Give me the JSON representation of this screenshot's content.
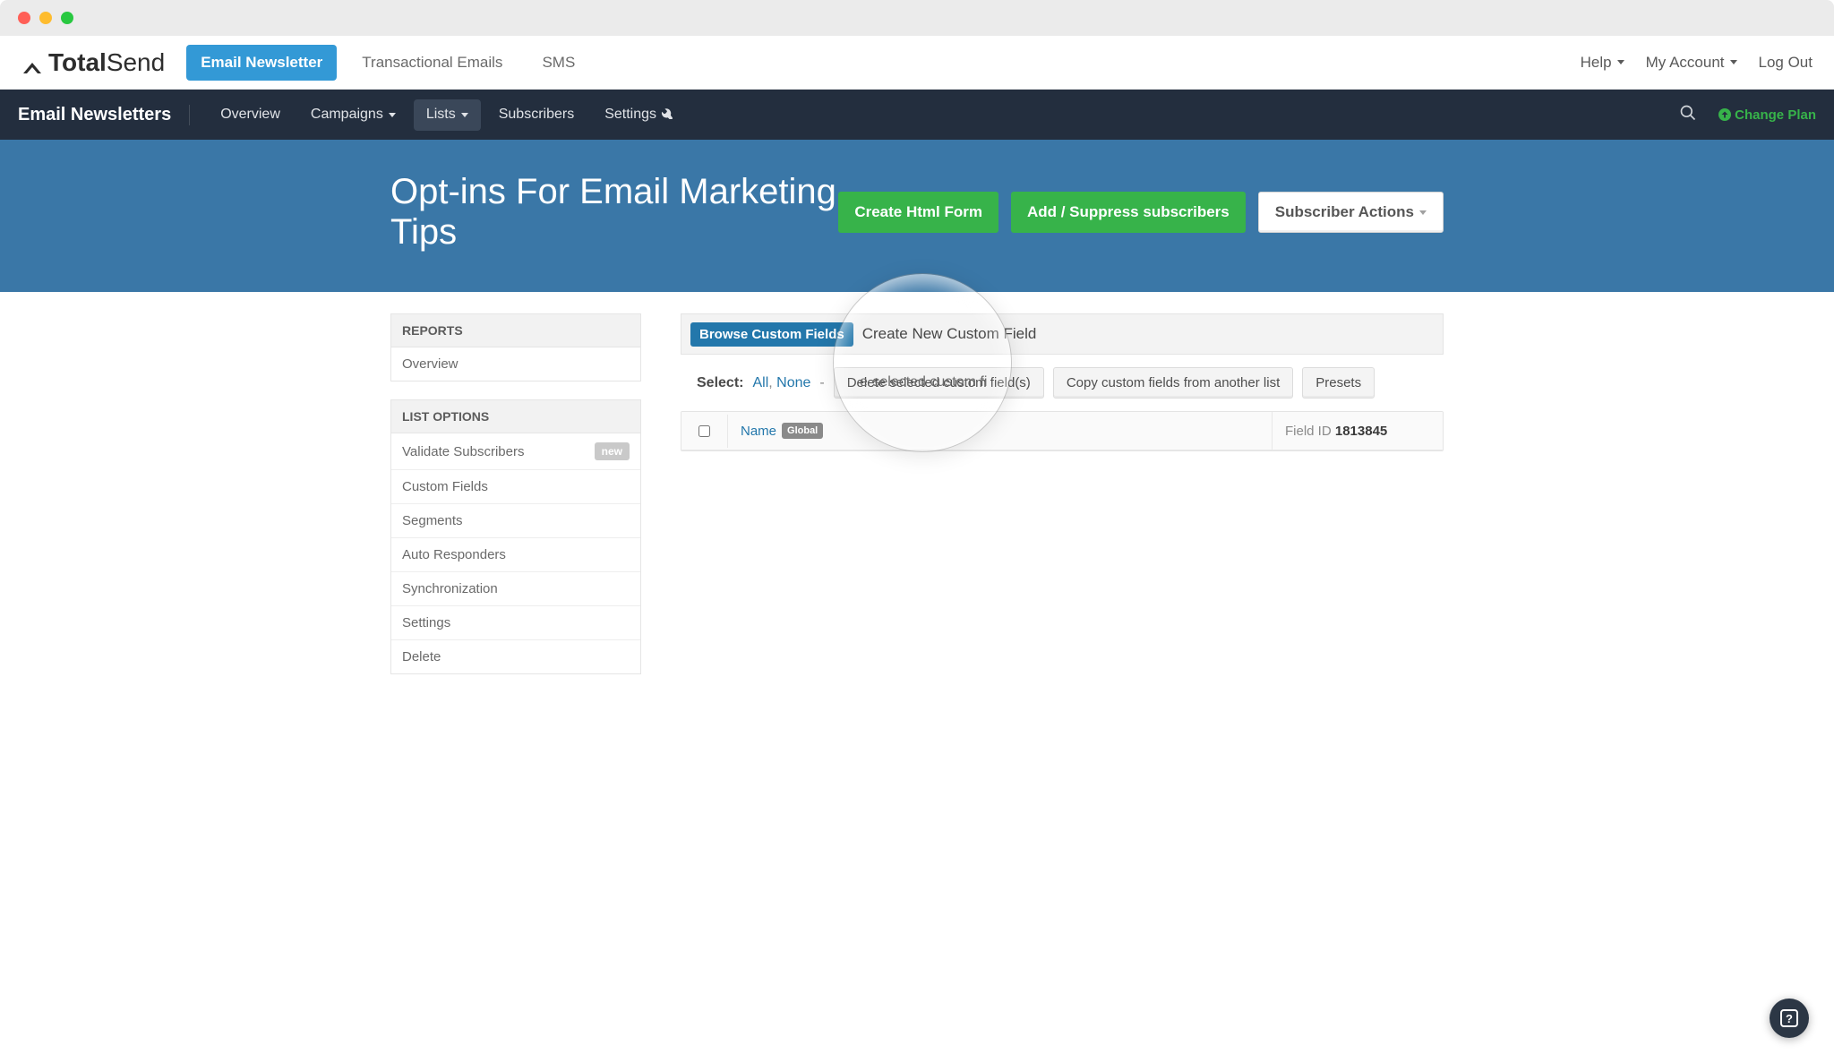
{
  "logo": {
    "bold": "Total",
    "light": "Send"
  },
  "top_tabs": {
    "email_newsletter": "Email Newsletter",
    "transactional": "Transactional Emails",
    "sms": "SMS"
  },
  "top_right": {
    "help": "Help",
    "account": "My Account",
    "logout": "Log Out"
  },
  "subnav": {
    "title": "Email Newsletters",
    "overview": "Overview",
    "campaigns": "Campaigns",
    "lists": "Lists",
    "subscribers": "Subscribers",
    "settings": "Settings",
    "change_plan": "Change Plan"
  },
  "header": {
    "title": "Opt-ins For Email Marketing Tips",
    "create_form": "Create Html Form",
    "add_suppress": "Add / Suppress subscribers",
    "subscriber_actions": "Subscriber Actions"
  },
  "sidebar": {
    "reports_header": "REPORTS",
    "reports_overview": "Overview",
    "list_options_header": "LIST OPTIONS",
    "items": {
      "validate": "Validate Subscribers",
      "validate_badge": "new",
      "custom_fields": "Custom Fields",
      "segments": "Segments",
      "auto_responders": "Auto Responders",
      "sync": "Synchronization",
      "settings": "Settings",
      "delete": "Delete"
    }
  },
  "tabs": {
    "browse": "Browse Custom Fields",
    "create": "Create New Custom Field"
  },
  "select_row": {
    "label": "Select:",
    "all": "All",
    "none": "None",
    "delete": "Delete selected custom field(s)",
    "copy": "Copy custom fields from another list",
    "presets": "Presets"
  },
  "table": {
    "name_label": "Name",
    "global_badge": "Global",
    "field_id_label": "Field ID",
    "field_id_value": "1813845"
  },
  "spotlight": {
    "label": "selected custom f"
  },
  "help_fab": "?"
}
